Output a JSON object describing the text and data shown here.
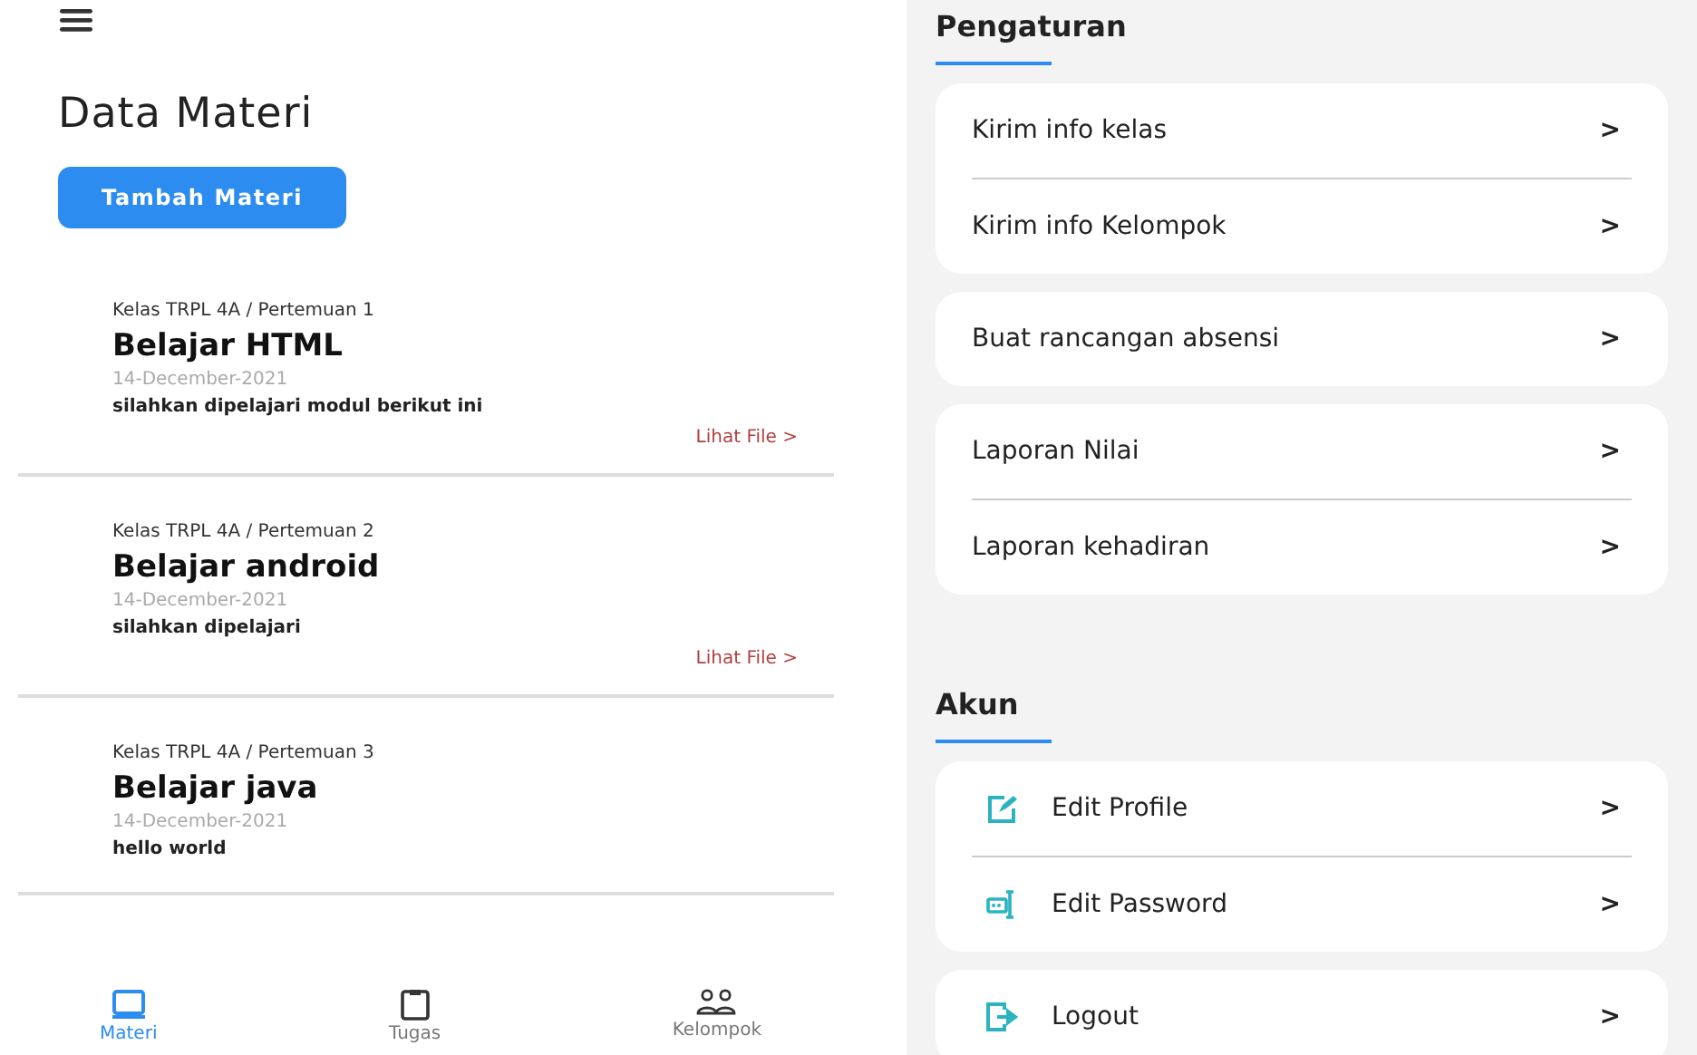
{
  "left": {
    "title": "Data Materi",
    "add_button": "Tambah Materi",
    "materi": [
      {
        "meta": "Kelas TRPL 4A / Pertemuan 1",
        "title": "Belajar HTML",
        "date": "14-December-2021",
        "description": "silahkan dipelajari modul berikut ini",
        "link": "Lihat File >"
      },
      {
        "meta": "Kelas TRPL 4A / Pertemuan 2",
        "title": "Belajar android",
        "date": "14-December-2021",
        "description": "silahkan dipelajari",
        "link": "Lihat File >"
      },
      {
        "meta": "Kelas TRPL 4A / Pertemuan 3",
        "title": "Belajar java",
        "date": "14-December-2021",
        "description": "hello world"
      }
    ],
    "nav": [
      {
        "label": "Materi",
        "kind": "laptop",
        "selected": true
      },
      {
        "label": "Tugas",
        "kind": "clipboard",
        "selected": false
      },
      {
        "label": "Kelompok",
        "kind": "group",
        "selected": false
      }
    ]
  },
  "right": {
    "sections": [
      {
        "title": "Pengaturan",
        "cards": [
          [
            {
              "label": "Kirim info kelas",
              "chevron": ">"
            },
            {
              "label": "Kirim info Kelompok",
              "chevron": ">"
            }
          ],
          [
            {
              "label": "Buat rancangan absensi",
              "chevron": ">"
            }
          ],
          [
            {
              "label": "Laporan Nilai",
              "chevron": ">"
            },
            {
              "label": "Laporan kehadiran",
              "chevron": ">"
            }
          ]
        ]
      },
      {
        "title": "Akun",
        "cards": [
          [
            {
              "label": "Edit Profile",
              "kind": "edit",
              "chevron": ">"
            },
            {
              "label": "Edit Password",
              "kind": "password",
              "chevron": ">"
            }
          ],
          [
            {
              "label": "Logout",
              "kind": "logout",
              "chevron": ">"
            }
          ]
        ]
      }
    ]
  }
}
